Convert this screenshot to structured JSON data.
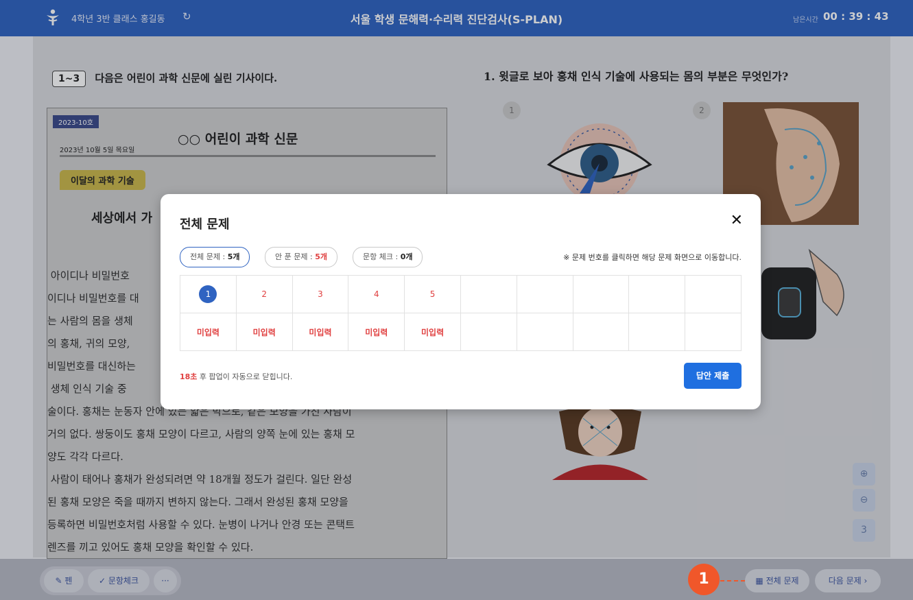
{
  "header": {
    "student": "4학년 3반 클래스 홍길동",
    "refresh_icon": "refresh-icon",
    "title": "서울 학생 문해력·수리력 진단검사(S-PLAN)",
    "timer_label": "남은시간",
    "timer": "00 : 39 : 43"
  },
  "passage": {
    "range": "1~3",
    "instruction": "다음은 어린이 과학 신문에 실린 기사이다.",
    "issue": "2023-10호",
    "paper_name": "○○ 어린이 과학 신문",
    "date": "2023년 10월 5일 목요일",
    "badge": "이달의 과학 기술",
    "heading": "세상에서 가",
    "body": " 아이디나 비밀번호\n이디나 비밀번호를 대\n는 사람의 몸을 생체\n의 홍채, 귀의 모양,\n비밀번호를 대신하는\n 생체 인식 기술 중\n술이다. 홍채는 눈동자 안에 있는 얇은 막으로, 같은 모양을 가진 사람이\n거의 없다. 쌍둥이도 홍채 모양이 다르고, 사람의 양쪽 눈에 있는 홍채 모\n양도 각각 다르다.\n 사람이 태어나 홍채가 완성되려면 약 18개월 정도가 걸린다. 일단 완성\n된 홍채 모양은 죽을 때까지 변하지 않는다. 그래서 완성된 홍채 모양을\n등록하면 비밀번호처럼 사용할 수 있다. 눈병이 나거나 안경 또는 콘택트\n렌즈를 끼고 있어도 홍채 모양을 확인할 수 있다."
  },
  "question": {
    "text": "1.  윗글로 보아 홍채 인식 기술에 사용되는 몸의 부분은 무엇인가?",
    "option1": "1",
    "option2": "2"
  },
  "zoom": {
    "zoom_in_icon": "zoom-in-icon",
    "zoom_out_icon": "zoom-out-icon",
    "level": "3"
  },
  "toolbar": {
    "pen": "펜",
    "check": "문항체크",
    "more": "···",
    "all_questions": "전체 문제",
    "next": "다음 문제 ›"
  },
  "modal": {
    "title": "전체 문제",
    "close": "✕",
    "chip_all_label": "전체 문제 : ",
    "chip_all_value": "5개",
    "chip_unsolved_label": "안 푼 문제 : ",
    "chip_unsolved_value": "5개",
    "chip_check_label": "문항 체크 : ",
    "chip_check_value": "0개",
    "hint": "※ 문제 번호를 클릭하면 해당 문제 화면으로 이동합니다.",
    "questions": [
      "1",
      "2",
      "3",
      "4",
      "5"
    ],
    "statuses": [
      "미입력",
      "미입력",
      "미입력",
      "미입력",
      "미입력"
    ],
    "countdown_secs": "18초",
    "countdown_text": " 후 팝업이 자동으로 닫힙니다.",
    "submit": "답안 제출"
  },
  "callout": "1",
  "colors": {
    "header": "#2f63c1",
    "accent_red": "#e04040",
    "submit": "#1f6fe0",
    "callout": "#f0572a"
  }
}
